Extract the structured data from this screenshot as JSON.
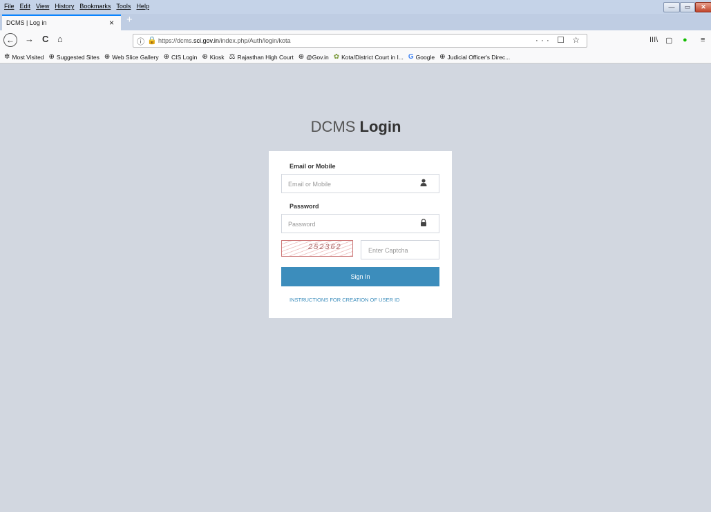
{
  "menu": [
    "File",
    "Edit",
    "View",
    "History",
    "Bookmarks",
    "Tools",
    "Help"
  ],
  "tab": {
    "title": "DCMS | Log in",
    "close": "×",
    "new": "+"
  },
  "nav": {
    "back": "←",
    "forward": "→",
    "reload": "C",
    "home": "⌂"
  },
  "urlbar": {
    "info_icon": "ⓘ",
    "url_prefix": "https://dcms.",
    "url_domain": "sci.gov.in",
    "url_path": "/index.php/Auth/login/kota",
    "actions": "··· ☐ ☆"
  },
  "toolbar_right": {
    "library": "III\\",
    "sidebar": "▢",
    "shield": "●",
    "menu": "≡"
  },
  "window_controls": {
    "minimize": "—",
    "maximize": "▭",
    "close": "✕"
  },
  "bookmarks": [
    {
      "icon": "✲",
      "label": "Most Visited"
    },
    {
      "icon": "⊕",
      "label": "Suggested Sites"
    },
    {
      "icon": "⊕",
      "label": "Web Slice Gallery"
    },
    {
      "icon": "⊕",
      "label": "CIS Login"
    },
    {
      "icon": "⊕",
      "label": "Kiosk"
    },
    {
      "icon": "⚖",
      "label": "Rajasthan High Court"
    },
    {
      "icon": "⊕",
      "label": "@Gov.in"
    },
    {
      "icon": "✿",
      "label": "Kota/District Court in I..."
    },
    {
      "icon": "G",
      "label": "Google"
    },
    {
      "icon": "⊕",
      "label": "Judicial Officer's Direc..."
    }
  ],
  "login": {
    "title_light": "DCMS",
    "title_bold": "Login",
    "email_label": "Email or Mobile",
    "email_placeholder": "Email or Mobile",
    "password_label": "Password",
    "password_placeholder": "Password",
    "captcha_text": "252362",
    "captcha_placeholder": "Enter Captcha",
    "signin_label": "Sign In",
    "instructions_link": "INSTRUCTIONS FOR CREATION OF USER ID",
    "user_icon": "👤",
    "lock_icon": "🔒"
  },
  "colors": {
    "accent": "#3c8dbc",
    "page_bg": "#d2d7e0",
    "secure_lock": "#12bc00"
  }
}
